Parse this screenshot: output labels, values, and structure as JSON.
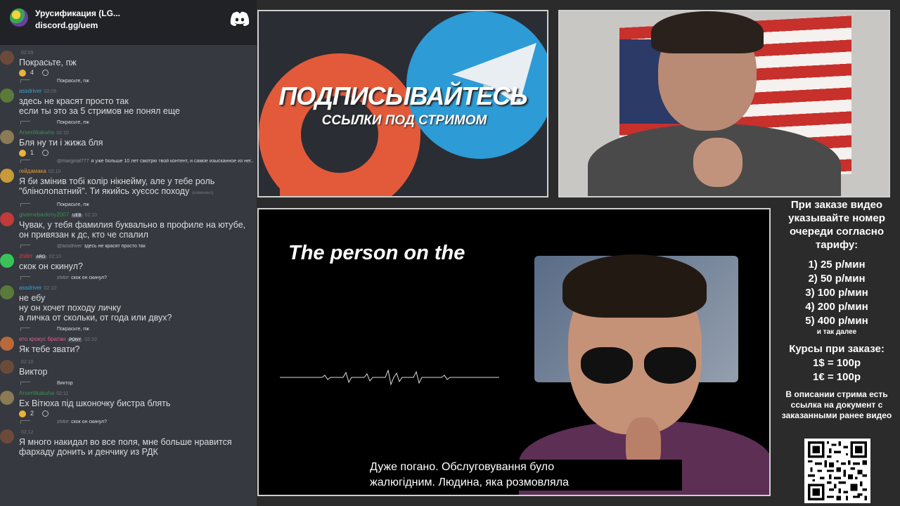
{
  "discord": {
    "server_name": "Урусификация (LG...",
    "invite": "discord.gg/uem"
  },
  "messages": [
    {
      "reply": null,
      "user": "",
      "user_color": "#3a8f55",
      "time": "02:09",
      "text": "Покрасьте, пж",
      "reactions": [
        {
          "count": "4"
        }
      ],
      "avatar_color": "#6b4a3a"
    },
    {
      "reply": {
        "name": "",
        "text": "Покрасьте, пж"
      },
      "user": "assdriver",
      "user_color": "#3aa0d6",
      "time": "02:09",
      "text": "здесь не красят просто так\nесли ты это за 5 стримов не понял еще",
      "reactions": [],
      "avatar_color": "#5a7a3a"
    },
    {
      "reply": {
        "name": "",
        "text": "Покрасьте, пж"
      },
      "user": "Arsenlikakaha",
      "user_color": "#3a8f55",
      "time": "02:10",
      "text": "Бля ну ти і жижа бля",
      "reactions": [
        {
          "count": "1"
        }
      ],
      "avatar_color": "#8a7a55"
    },
    {
      "reply": {
        "name": "@marginal777",
        "text": "я уже больше 10 лет смотрю твой контент, и самое изысканное из нег..."
      },
      "user": "гейдамака",
      "user_color": "#e39a3a",
      "time": "02:10",
      "text": "Я би змінив тобі колір нікнейму, але у тебе роль\n\"блінолопатний\". Ти якийсь хуєсос походу",
      "edited": "(изменено)",
      "reactions": [],
      "avatar_color": "#c79a3a"
    },
    {
      "reply": {
        "name": "",
        "text": "Покрасьте, пж"
      },
      "user": "givemebackmy2007",
      "user_color": "#3a8f55",
      "time": "02:10",
      "tag": "UEB",
      "text": "Чувак, у тебя фамилия буквально в профиле на ютубе,\nон привязан к дс, кто че спалил",
      "reactions": [],
      "avatar_color": "#c23a3a"
    },
    {
      "reply": {
        "name": "@assdriver",
        "text": "здесь не красят просто так"
      },
      "user": "zhitirr",
      "user_color": "#e33a3a",
      "time": "02:10",
      "tag": "ARG",
      "text": "скок он скинул?",
      "reactions": [],
      "avatar_color": "#3ac25a"
    },
    {
      "reply": {
        "name": "zhitirr",
        "text": "скок он скинул?"
      },
      "user": "assdriver",
      "user_color": "#3aa0d6",
      "time": "02:10",
      "text": "не ебу\nну он хочет походу личку\nа личка от скольки, от года или двух?",
      "reactions": [],
      "avatar_color": "#5a7a3a"
    },
    {
      "reply": {
        "name": "",
        "text": "Покрасьте, пж"
      },
      "user": "ето крокус братан",
      "user_color": "#e35a9a",
      "time": "02:10",
      "tag": "PONY",
      "text": "Як тебе звати?",
      "reactions": [],
      "avatar_color": "#b86a3a"
    },
    {
      "reply": null,
      "user": "",
      "user_color": "#3a8f55",
      "time": "02:10",
      "text": "Виктор",
      "reactions": [],
      "avatar_color": "#6b4a3a"
    },
    {
      "reply": {
        "name": "",
        "text": "Виктор"
      },
      "user": "Arsenlikakaha",
      "user_color": "#3a8f55",
      "time": "02:11",
      "text": "Ех Вітюха під шконочку бистра блять",
      "reactions": [
        {
          "count": "2"
        }
      ],
      "avatar_color": "#8a7a55"
    },
    {
      "reply": {
        "name": "zhitirr",
        "text": "скок он скинул?"
      },
      "user": "",
      "user_color": "#3a8f55",
      "time": "02:12",
      "text": "Я много накидал во все поля, мне больше нравится\nфархаду донить и денчику из РДК",
      "reactions": [],
      "avatar_color": "#6b4a3a"
    }
  ],
  "banner": {
    "title": "ПОДПИСЫВАЙТЕСЬ",
    "subtitle": "ССЫЛКИ ПОД СТРИМОМ"
  },
  "video": {
    "heading": "The person on the",
    "subtitle_line1": "Дуже погано.  Обслуговування було",
    "subtitle_line2": "жалюгідним.  Людина, яка розмовляла"
  },
  "info": {
    "intro": "При заказе видео указывайте номер очереди согласно тарифу:",
    "rates": [
      "1) 25 р/мин",
      "2) 50 р/мин",
      "3) 100 р/мин",
      "4) 200 р/мин",
      "5) 400 р/мин"
    ],
    "rates_more": "и так далее",
    "courses_title": "Курсы при заказе:",
    "course_usd": "1$ = 100р",
    "course_eur": "1€ = 100р",
    "description": "В описании стрима есть ссылка на документ с заказанными ранее видео"
  }
}
